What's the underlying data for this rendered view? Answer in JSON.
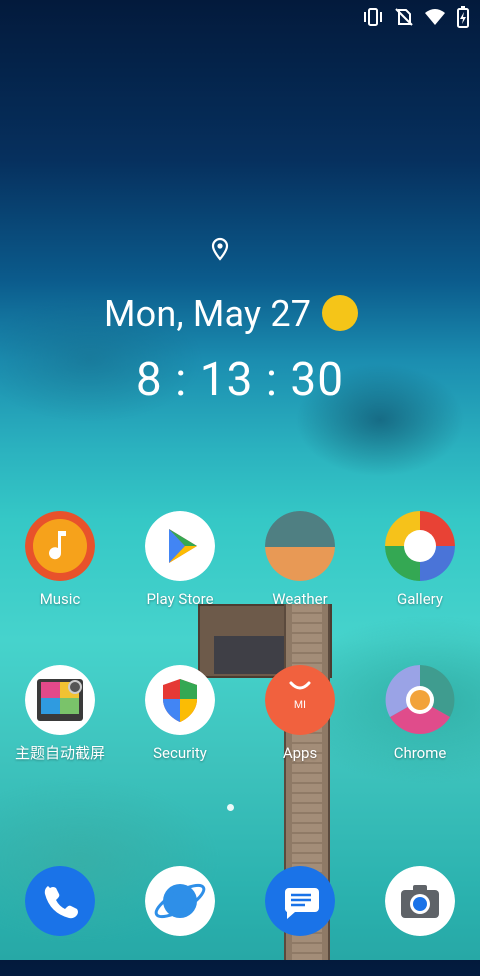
{
  "status_bar": {
    "icons": [
      "vibrate-icon",
      "no-sim-icon",
      "wifi-icon",
      "battery-charging-icon"
    ]
  },
  "widget": {
    "date": "Mon, May 27",
    "time": "8 : 13 : 30",
    "weather_icon": "sun-icon",
    "location_icon": "location-pin-icon",
    "sun_color": "#f5c518"
  },
  "apps": [
    {
      "label": "Music",
      "icon": "music-icon"
    },
    {
      "label": "Play Store",
      "icon": "play-store-icon"
    },
    {
      "label": "Weather",
      "icon": "weather-icon"
    },
    {
      "label": "Gallery",
      "icon": "gallery-icon"
    },
    {
      "label": "主题自动截屏",
      "icon": "screenshot-app-icon"
    },
    {
      "label": "Security",
      "icon": "security-shield-icon"
    },
    {
      "label": "Apps",
      "icon": "apps-store-icon"
    },
    {
      "label": "Chrome",
      "icon": "chrome-icon"
    }
  ],
  "dock": [
    {
      "name": "Phone",
      "icon": "phone-icon"
    },
    {
      "name": "Browser",
      "icon": "browser-planet-icon"
    },
    {
      "name": "Messages",
      "icon": "messages-icon"
    },
    {
      "name": "Camera",
      "icon": "camera-icon"
    }
  ],
  "page_indicator": {
    "current": 1,
    "total": 1
  }
}
